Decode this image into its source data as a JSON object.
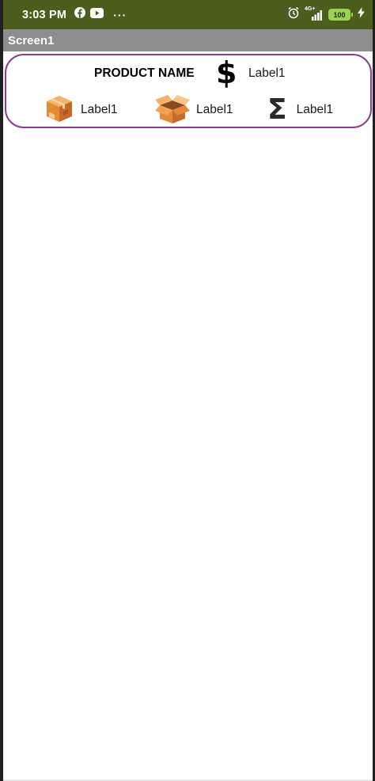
{
  "status_bar": {
    "time": "3:03 PM",
    "app_icons": [
      "facebook-icon",
      "youtube-icon"
    ],
    "more_indicator": "···",
    "network": "4G+",
    "battery": "100",
    "background_color": "#4c5e1e"
  },
  "title_bar": {
    "title": "Screen1",
    "background_color": "#8d8d8d"
  },
  "card": {
    "border_color": "#8a3d8a",
    "product_name": "PRODUCT NAME",
    "price_icon": "$",
    "price_label": "Label1",
    "items": [
      {
        "icon": "closed-box-icon",
        "label": "Label1"
      },
      {
        "icon": "open-box-icon",
        "label": "Label1"
      },
      {
        "icon": "Σ",
        "icon_name": "sigma-icon",
        "label": "Label1"
      }
    ]
  }
}
